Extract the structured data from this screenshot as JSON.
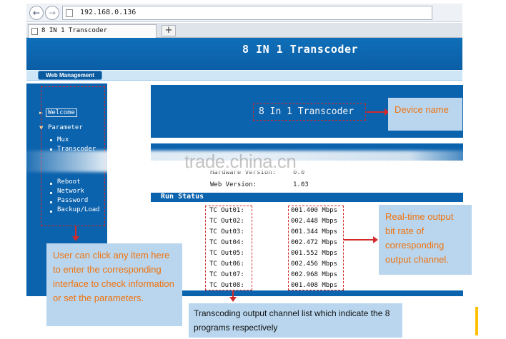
{
  "browser": {
    "back_icon": "back-arrow-icon",
    "forward_icon": "forward-arrow-icon",
    "url": "192.168.0.136",
    "tab_title": "8 IN 1 Transcoder",
    "new_tab_label": "+"
  },
  "header": {
    "title": "8 IN 1 Transcoder"
  },
  "menu": {
    "web_management": "Web Management"
  },
  "sidebar": {
    "welcome": "Welcome",
    "parameter": "Parameter",
    "mux": "Mux",
    "transcoder": "Transcoder",
    "reboot": "Reboot",
    "network": "Network",
    "password": "Password",
    "backup_load": "Backup/Load"
  },
  "device": {
    "name": "8 In 1 Transcoder"
  },
  "version_info": {
    "hardware_label": "Hardware Version:",
    "hardware_value": "0.0",
    "web_label": "Web Version:",
    "web_value": "1.03"
  },
  "run_status": {
    "title": "Run Status",
    "rows": [
      {
        "name": "TC Out01:",
        "value": "001.400 Mbps"
      },
      {
        "name": "TC Out02:",
        "value": "002.448 Mbps"
      },
      {
        "name": "TC Out03:",
        "value": "001.344 Mbps"
      },
      {
        "name": "TC Out04:",
        "value": "002.472 Mbps"
      },
      {
        "name": "TC Out05:",
        "value": "001.552 Mbps"
      },
      {
        "name": "TC Out06:",
        "value": "002.456 Mbps"
      },
      {
        "name": "TC Out07:",
        "value": "002.968 Mbps"
      },
      {
        "name": "TC Out08:",
        "value": "001.408 Mbps"
      }
    ]
  },
  "watermark": "trade.china.cn",
  "annotations": {
    "device_name": "Device name",
    "bitrate": "Real-time output bit rate of corresponding output channel.",
    "sidebar_help": "User can click any item here to enter the corresponding interface to check information or set the parameters.",
    "channel_list": "Transcoding output channel list which indicate the 8 programs respectively"
  },
  "colors": {
    "page_blue": "#0b62ad",
    "annotation_fill": "#b9d6ee",
    "annotation_text": "#f0730f",
    "dash_red": "#d22a2a"
  }
}
